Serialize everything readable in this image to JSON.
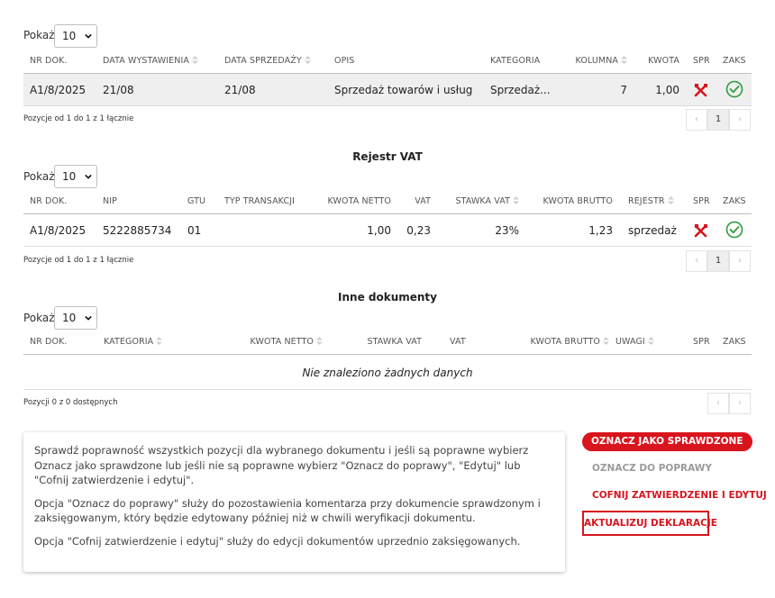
{
  "colors": {
    "accent_red": "#d8141d",
    "check_green": "#2e9b3e",
    "disabled_text": "#9a9a9a"
  },
  "page_size_label": "Pokaż",
  "page_size_value": "10",
  "table1": {
    "headers": [
      "NR DOK.",
      "DATA WYSTAWIENIA",
      "DATA SPRZEDAŻY",
      "OPIS",
      "KATEGORIA",
      "KOLUMNA",
      "KWOTA",
      "SPR",
      "ZAKS"
    ],
    "rows": [
      {
        "nr_dok": "A1/8/2025",
        "data_wystawienia": "21/08",
        "data_sprzedazy": "21/08",
        "opis": "Sprzedaż towarów i usług",
        "kategoria": "Sprzedaż...",
        "kolumna": "7",
        "kwota": "1,00",
        "spr_icon": "tools-icon",
        "zaks_icon": "check-circle-icon"
      }
    ],
    "info": "Pozycje od 1 do 1 z 1 łącznie",
    "current_page": "1"
  },
  "table2": {
    "title": "Rejestr VAT",
    "headers": [
      "NR DOK.",
      "NIP",
      "GTU",
      "TYP TRANSAKCJI",
      "KWOTA NETTO",
      "VAT",
      "STAWKA VAT",
      "KWOTA BRUTTO",
      "REJESTR",
      "SPR",
      "ZAKS"
    ],
    "rows": [
      {
        "nr_dok": "A1/8/2025",
        "nip": "5222885734",
        "gtu": "01",
        "typ": "",
        "netto": "1,00",
        "vat": "0,23",
        "stawka": "23%",
        "brutto": "1,23",
        "rejestr": "sprzedaż",
        "spr_icon": "tools-icon",
        "zaks_icon": "check-circle-icon"
      }
    ],
    "info": "Pozycje od 1 do 1 z 1 łącznie",
    "current_page": "1"
  },
  "table3": {
    "title": "Inne dokumenty",
    "headers": [
      "NR DOK.",
      "KATEGORIA",
      "KWOTA NETTO",
      "STAWKA VAT",
      "VAT",
      "KWOTA BRUTTO",
      "UWAGI",
      "SPR",
      "ZAKS"
    ],
    "empty": "Nie znaleziono żadnych danych",
    "info": "Pozycji 0 z 0 dostępnych"
  },
  "card": {
    "p1": "Sprawdź poprawność wszystkich pozycji dla wybranego dokumentu i jeśli są poprawne wybierz Oznacz jako sprawdzone lub jeśli nie są poprawne wybierz \"Oznacz do poprawy\", \"Edytuj\" lub \"Cofnij zatwierdzenie i edytuj\".",
    "p2": "Opcja \"Oznacz do poprawy\" służy do pozostawienia komentarza przy dokumencie sprawdzonym i zaksięgowanym, który będzie edytowany później niż w chwili weryfikacji dokumentu.",
    "p3": "Opcja \"Cofnij zatwierdzenie i edytuj\" służy do edycji dokumentów uprzednio zaksięgowanych."
  },
  "actions": {
    "mark_checked": "OZNACZ JAKO SPRAWDZONE",
    "mark_fix": "OZNACZ DO POPRAWY",
    "revert_edit": "COFNIJ ZATWIERDZENIE I EDYTUJ",
    "update_decl": "AKTUALIZUJ DEKLARACJE"
  }
}
